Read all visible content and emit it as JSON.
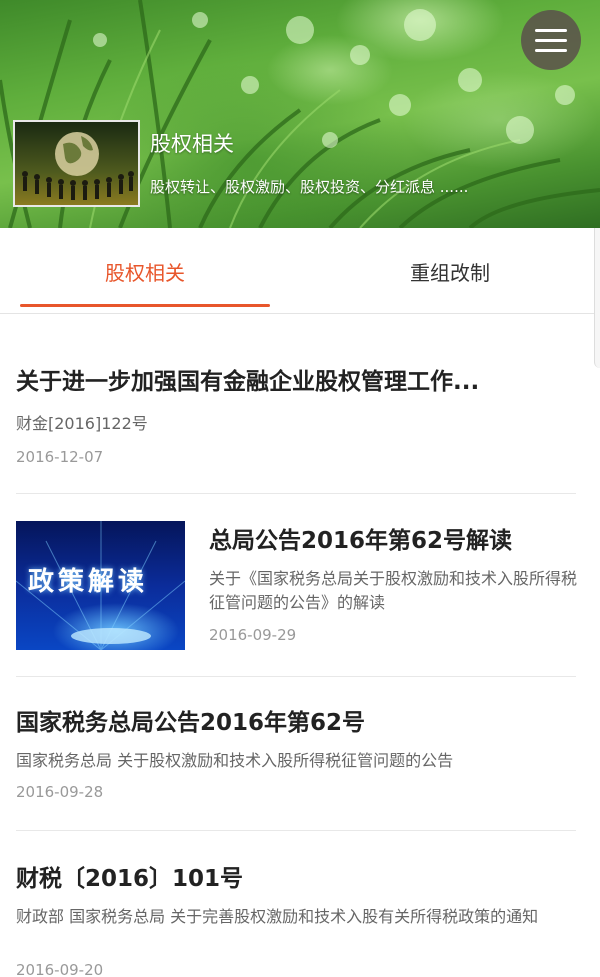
{
  "header": {
    "title": "股权相关",
    "subtitle": "股权转让、股权激励、股权投资、分红派息 ......",
    "menu_icon": "hamburger-menu-icon"
  },
  "tabs": [
    {
      "label": "股权相关",
      "active": true
    },
    {
      "label": "重组改制",
      "active": false
    }
  ],
  "accent_color": "#e8562b",
  "articles": [
    {
      "title": "关于进一步加强国有金融企业股权管理工作...",
      "desc": "财金[2016]122号",
      "date": "2016-12-07"
    },
    {
      "title": "总局公告2016年第62号解读",
      "desc": "关于《国家税务总局关于股权激励和技术入股所得税征管问题的公告》的解读",
      "date": "2016-09-29",
      "thumbnail_text": "政策解读"
    },
    {
      "title": "国家税务总局公告2016年第62号",
      "desc": "国家税务总局 关于股权激励和技术入股所得税征管问题的公告",
      "date": "2016-09-28"
    },
    {
      "title": "财税〔2016〕101号",
      "desc": "财政部 国家税务总局 关于完善股权激励和技术入股有关所得税政策的通知",
      "date": "2016-09-20"
    }
  ]
}
